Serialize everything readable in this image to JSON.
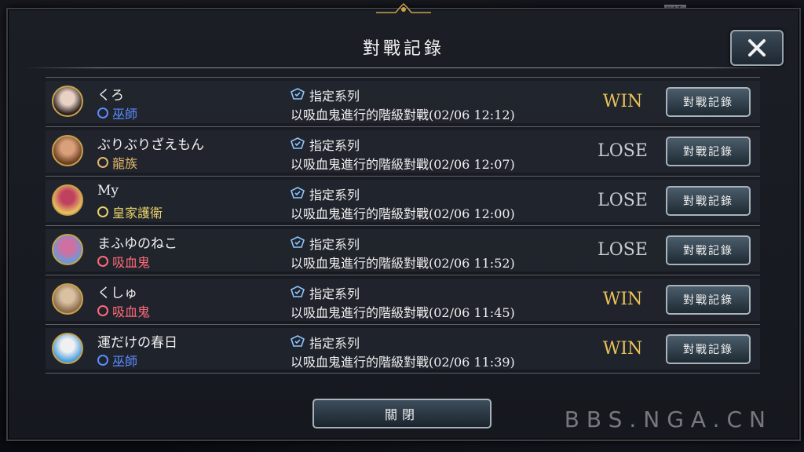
{
  "hat_tag": "HAT",
  "title": "對戰記錄",
  "close_label": "關閉",
  "watermark": "BBS.NGA.CN",
  "rows": [
    {
      "name": "くろ",
      "class": "巫師",
      "class_color": "#5b8cff",
      "mode": "指定系列",
      "match": "以吸血鬼進行的階級對戰(02/06 12:12)",
      "result": "WIN",
      "button": "對戰記錄"
    },
    {
      "name": "ぶりぶりざえもん",
      "class": "龍族",
      "class_color": "#e2b86a",
      "mode": "指定系列",
      "match": "以吸血鬼進行的階級對戰(02/06 12:07)",
      "result": "LOSE",
      "button": "對戰記錄"
    },
    {
      "name": "My",
      "class": "皇家護衛",
      "class_color": "#e8d16a",
      "mode": "指定系列",
      "match": "以吸血鬼進行的階級對戰(02/06 12:00)",
      "result": "LOSE",
      "button": "對戰記錄"
    },
    {
      "name": "まふゆのねこ",
      "class": "吸血鬼",
      "class_color": "#ff6a7a",
      "mode": "指定系列",
      "match": "以吸血鬼進行的階級對戰(02/06 11:52)",
      "result": "LOSE",
      "button": "對戰記錄"
    },
    {
      "name": "くしゅ",
      "class": "吸血鬼",
      "class_color": "#ff6a7a",
      "mode": "指定系列",
      "match": "以吸血鬼進行的階級對戰(02/06 11:45)",
      "result": "WIN",
      "button": "對戰記錄"
    },
    {
      "name": "運だけの春日",
      "class": "巫師",
      "class_color": "#5b8cff",
      "mode": "指定系列",
      "match": "以吸血鬼進行的階級對戰(02/06 11:39)",
      "result": "WIN",
      "button": "對戰記錄"
    }
  ],
  "avatars": [
    {
      "colors": [
        "#2a1f1f",
        "#e9d2c4"
      ]
    },
    {
      "colors": [
        "#6b3e21",
        "#d9a07a"
      ]
    },
    {
      "colors": [
        "#e8c060",
        "#c04060"
      ]
    },
    {
      "colors": [
        "#6a9ad8",
        "#d070a0"
      ]
    },
    {
      "colors": [
        "#8a6a4a",
        "#d8c0a0"
      ]
    },
    {
      "colors": [
        "#4aa0e0",
        "#f0f0f0"
      ]
    }
  ]
}
